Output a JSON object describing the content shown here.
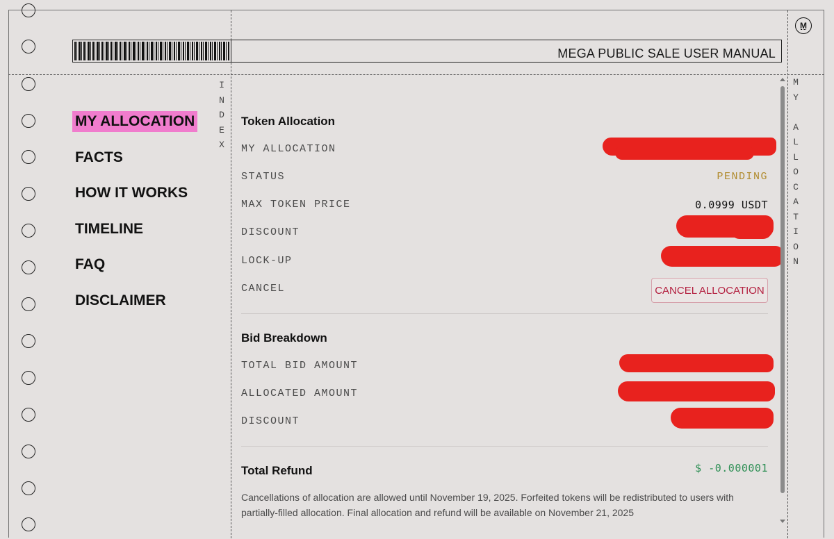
{
  "header": {
    "title": "MEGA PUBLIC SALE USER MANUAL",
    "logo_letter": "M"
  },
  "nav": {
    "items": [
      {
        "label": "MY ALLOCATION",
        "active": true
      },
      {
        "label": "FACTS"
      },
      {
        "label": "HOW IT WORKS"
      },
      {
        "label": "TIMELINE"
      },
      {
        "label": "FAQ"
      },
      {
        "label": "DISCLAIMER"
      }
    ]
  },
  "side_labels": {
    "index": "INDEX",
    "section": "MY ALLOCATION"
  },
  "token_allocation": {
    "title": "Token Allocation",
    "rows": {
      "my_allocation": {
        "label": "MY ALLOCATION"
      },
      "status": {
        "label": "STATUS",
        "value": "PENDING"
      },
      "max_token_price": {
        "label": "MAX TOKEN PRICE",
        "value": "0.0999 USDT"
      },
      "discount": {
        "label": "DISCOUNT"
      },
      "lock_up": {
        "label": "LOCK-UP"
      },
      "cancel": {
        "label": "CANCEL",
        "button": "CANCEL ALLOCATION"
      }
    }
  },
  "bid_breakdown": {
    "title": "Bid Breakdown",
    "rows": {
      "total_bid_amount": {
        "label": "TOTAL BID AMOUNT"
      },
      "allocated_amount": {
        "label": "ALLOCATED AMOUNT"
      },
      "discount": {
        "label": "DISCOUNT"
      }
    }
  },
  "refund": {
    "title": "Total Refund",
    "value": "$ -0.000001",
    "note": "Cancellations of allocation are allowed until November 19, 2025. Forfeited tokens will be redistributed to users with partially-filled allocation. Final allocation and refund will be available on November 21, 2025"
  },
  "colors": {
    "active_nav": "#f07ccd",
    "pending": "#b08a2c",
    "refund": "#2e8f55",
    "cancel_button_text": "#b31e3e",
    "redaction": "#e8221e"
  }
}
